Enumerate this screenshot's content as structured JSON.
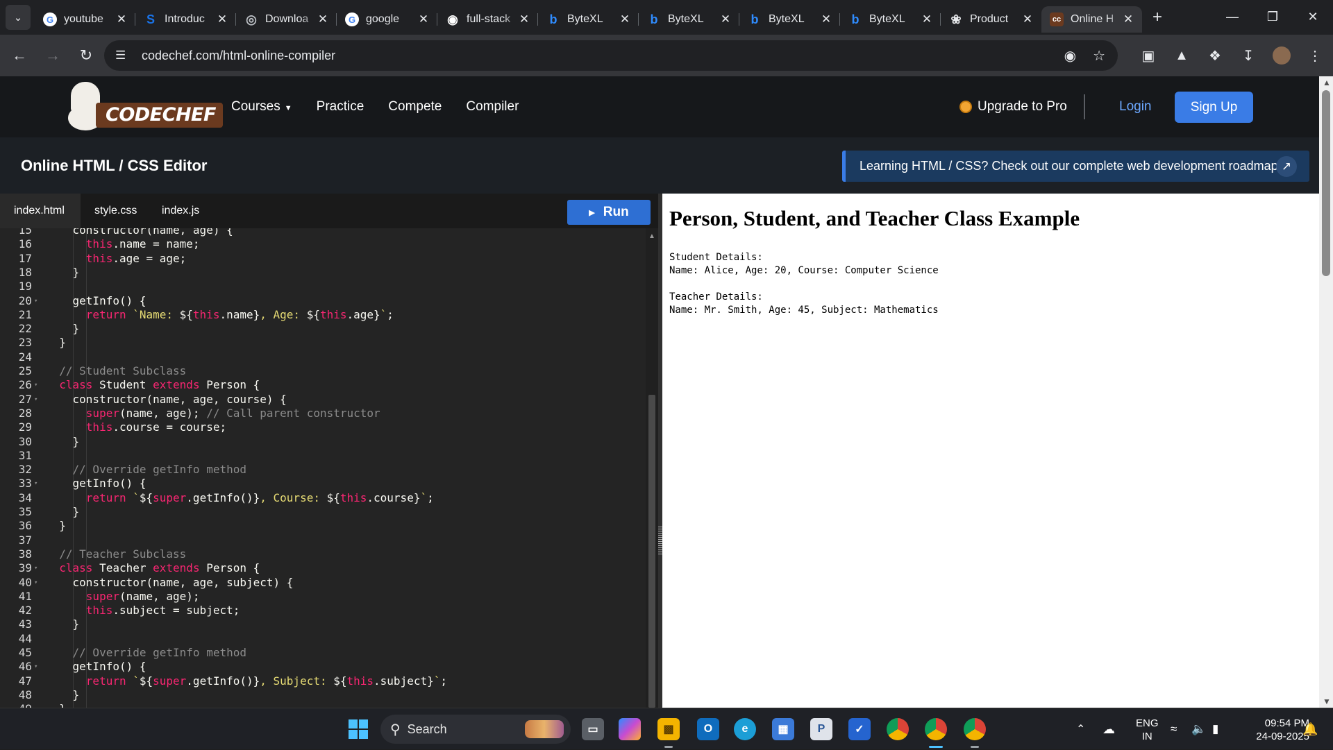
{
  "browser": {
    "tabs": [
      {
        "title": "youtube",
        "icon": "google-g-icon",
        "color": "#4285f4"
      },
      {
        "title": "Introduc",
        "icon": "s-logo-icon",
        "color": "#1a73e8"
      },
      {
        "title": "Downloa",
        "icon": "globe-icon",
        "color": "#bdc1c6"
      },
      {
        "title": "google",
        "icon": "google-g-icon",
        "color": "#4285f4"
      },
      {
        "title": "full-stack",
        "icon": "github-icon",
        "color": "#ffffff"
      },
      {
        "title": "ByteXL",
        "icon": "bytexl-b-icon",
        "color": "#2f8cff"
      },
      {
        "title": "ByteXL",
        "icon": "bytexl-b-icon",
        "color": "#2f8cff"
      },
      {
        "title": "ByteXL",
        "icon": "bytexl-b-icon",
        "color": "#2f8cff"
      },
      {
        "title": "ByteXL",
        "icon": "bytexl-b-icon",
        "color": "#2f8cff"
      },
      {
        "title": "Product",
        "icon": "openai-icon",
        "color": "#e8eaed"
      },
      {
        "title": "Online H",
        "icon": "codechef-cc-icon",
        "color": "#6b3a1f"
      }
    ],
    "url": "codechef.com/html-online-compiler"
  },
  "site": {
    "logo_text": "CODECHEF",
    "menu": {
      "courses": "Courses",
      "practice": "Practice",
      "compete": "Compete",
      "compiler": "Compiler"
    },
    "upgrade": "Upgrade to Pro",
    "login": "Login",
    "signup": "Sign Up",
    "editor_title": "Online HTML / CSS Editor",
    "roadmap_banner": "Learning HTML / CSS? Check out our complete web development roadmap"
  },
  "editor": {
    "tabs": {
      "html": "index.html",
      "css": "style.css",
      "js": "index.js"
    },
    "run_label": "Run",
    "lines": [
      {
        "n": "15",
        "tokens": [
          {
            "t": "    constructor(name, age) {",
            "c": "n"
          }
        ]
      },
      {
        "n": "16",
        "tokens": [
          {
            "t": "      ",
            "c": "n"
          },
          {
            "t": "this",
            "c": "th"
          },
          {
            "t": ".name = name;",
            "c": "n"
          }
        ]
      },
      {
        "n": "17",
        "tokens": [
          {
            "t": "      ",
            "c": "n"
          },
          {
            "t": "this",
            "c": "th"
          },
          {
            "t": ".age = age;",
            "c": "n"
          }
        ]
      },
      {
        "n": "18",
        "tokens": [
          {
            "t": "    }",
            "c": "n"
          }
        ]
      },
      {
        "n": "19",
        "tokens": []
      },
      {
        "n": "20",
        "fold": true,
        "tokens": [
          {
            "t": "    getInfo() {",
            "c": "n"
          }
        ]
      },
      {
        "n": "21",
        "tokens": [
          {
            "t": "      ",
            "c": "n"
          },
          {
            "t": "return",
            "c": "k"
          },
          {
            "t": " `Name: ",
            "c": "s"
          },
          {
            "t": "${",
            "c": "n"
          },
          {
            "t": "this",
            "c": "th"
          },
          {
            "t": ".name}",
            "c": "n"
          },
          {
            "t": ", Age: ",
            "c": "s"
          },
          {
            "t": "${",
            "c": "n"
          },
          {
            "t": "this",
            "c": "th"
          },
          {
            "t": ".age}",
            "c": "n"
          },
          {
            "t": "`",
            "c": "s"
          },
          {
            "t": ";",
            "c": "n"
          }
        ]
      },
      {
        "n": "22",
        "tokens": [
          {
            "t": "    }",
            "c": "n"
          }
        ]
      },
      {
        "n": "23",
        "tokens": [
          {
            "t": "  }",
            "c": "n"
          }
        ]
      },
      {
        "n": "24",
        "tokens": []
      },
      {
        "n": "25",
        "tokens": [
          {
            "t": "  // Student Subclass",
            "c": "c"
          }
        ]
      },
      {
        "n": "26",
        "fold": true,
        "tokens": [
          {
            "t": "  ",
            "c": "n"
          },
          {
            "t": "class",
            "c": "k"
          },
          {
            "t": " Student ",
            "c": "n"
          },
          {
            "t": "extends",
            "c": "k"
          },
          {
            "t": " Person {",
            "c": "n"
          }
        ]
      },
      {
        "n": "27",
        "fold": true,
        "tokens": [
          {
            "t": "    constructor(name, age, course) {",
            "c": "n"
          }
        ]
      },
      {
        "n": "28",
        "tokens": [
          {
            "t": "      ",
            "c": "n"
          },
          {
            "t": "super",
            "c": "th"
          },
          {
            "t": "(name, age); ",
            "c": "n"
          },
          {
            "t": "// Call parent constructor",
            "c": "c"
          }
        ]
      },
      {
        "n": "29",
        "tokens": [
          {
            "t": "      ",
            "c": "n"
          },
          {
            "t": "this",
            "c": "th"
          },
          {
            "t": ".course = course;",
            "c": "n"
          }
        ]
      },
      {
        "n": "30",
        "tokens": [
          {
            "t": "    }",
            "c": "n"
          }
        ]
      },
      {
        "n": "31",
        "tokens": []
      },
      {
        "n": "32",
        "tokens": [
          {
            "t": "    // Override getInfo method",
            "c": "c"
          }
        ]
      },
      {
        "n": "33",
        "fold": true,
        "tokens": [
          {
            "t": "    getInfo() {",
            "c": "n"
          }
        ]
      },
      {
        "n": "34",
        "tokens": [
          {
            "t": "      ",
            "c": "n"
          },
          {
            "t": "return",
            "c": "k"
          },
          {
            "t": " `",
            "c": "s"
          },
          {
            "t": "${",
            "c": "n"
          },
          {
            "t": "super",
            "c": "th"
          },
          {
            "t": ".getInfo()}",
            "c": "n"
          },
          {
            "t": ", Course: ",
            "c": "s"
          },
          {
            "t": "${",
            "c": "n"
          },
          {
            "t": "this",
            "c": "th"
          },
          {
            "t": ".course}",
            "c": "n"
          },
          {
            "t": "`",
            "c": "s"
          },
          {
            "t": ";",
            "c": "n"
          }
        ]
      },
      {
        "n": "35",
        "tokens": [
          {
            "t": "    }",
            "c": "n"
          }
        ]
      },
      {
        "n": "36",
        "tokens": [
          {
            "t": "  }",
            "c": "n"
          }
        ]
      },
      {
        "n": "37",
        "tokens": []
      },
      {
        "n": "38",
        "tokens": [
          {
            "t": "  // Teacher Subclass",
            "c": "c"
          }
        ]
      },
      {
        "n": "39",
        "fold": true,
        "tokens": [
          {
            "t": "  ",
            "c": "n"
          },
          {
            "t": "class",
            "c": "k"
          },
          {
            "t": " Teacher ",
            "c": "n"
          },
          {
            "t": "extends",
            "c": "k"
          },
          {
            "t": " Person {",
            "c": "n"
          }
        ]
      },
      {
        "n": "40",
        "fold": true,
        "tokens": [
          {
            "t": "    constructor(name, age, subject) {",
            "c": "n"
          }
        ]
      },
      {
        "n": "41",
        "tokens": [
          {
            "t": "      ",
            "c": "n"
          },
          {
            "t": "super",
            "c": "th"
          },
          {
            "t": "(name, age);",
            "c": "n"
          }
        ]
      },
      {
        "n": "42",
        "tokens": [
          {
            "t": "      ",
            "c": "n"
          },
          {
            "t": "this",
            "c": "th"
          },
          {
            "t": ".subject = subject;",
            "c": "n"
          }
        ]
      },
      {
        "n": "43",
        "tokens": [
          {
            "t": "    }",
            "c": "n"
          }
        ]
      },
      {
        "n": "44",
        "tokens": []
      },
      {
        "n": "45",
        "tokens": [
          {
            "t": "    // Override getInfo method",
            "c": "c"
          }
        ]
      },
      {
        "n": "46",
        "fold": true,
        "tokens": [
          {
            "t": "    getInfo() {",
            "c": "n"
          }
        ]
      },
      {
        "n": "47",
        "tokens": [
          {
            "t": "      ",
            "c": "n"
          },
          {
            "t": "return",
            "c": "k"
          },
          {
            "t": " `",
            "c": "s"
          },
          {
            "t": "${",
            "c": "n"
          },
          {
            "t": "super",
            "c": "th"
          },
          {
            "t": ".getInfo()}",
            "c": "n"
          },
          {
            "t": ", Subject: ",
            "c": "s"
          },
          {
            "t": "${",
            "c": "n"
          },
          {
            "t": "this",
            "c": "th"
          },
          {
            "t": ".subject}",
            "c": "n"
          },
          {
            "t": "`",
            "c": "s"
          },
          {
            "t": ";",
            "c": "n"
          }
        ]
      },
      {
        "n": "48",
        "tokens": [
          {
            "t": "    }",
            "c": "n"
          }
        ]
      },
      {
        "n": "49",
        "tokens": [
          {
            "t": "  }",
            "c": "n"
          }
        ]
      }
    ]
  },
  "output": {
    "heading": "Person, Student, and Teacher Class Example",
    "text": "Student Details:\nName: Alice, Age: 20, Course: Computer Science\n\nTeacher Details:\nName: Mr. Smith, Age: 45, Subject: Mathematics"
  },
  "taskbar": {
    "search_label": "Search",
    "lang_top": "ENG",
    "lang_bottom": "IN",
    "time": "09:54 PM",
    "date": "24-09-2025"
  }
}
